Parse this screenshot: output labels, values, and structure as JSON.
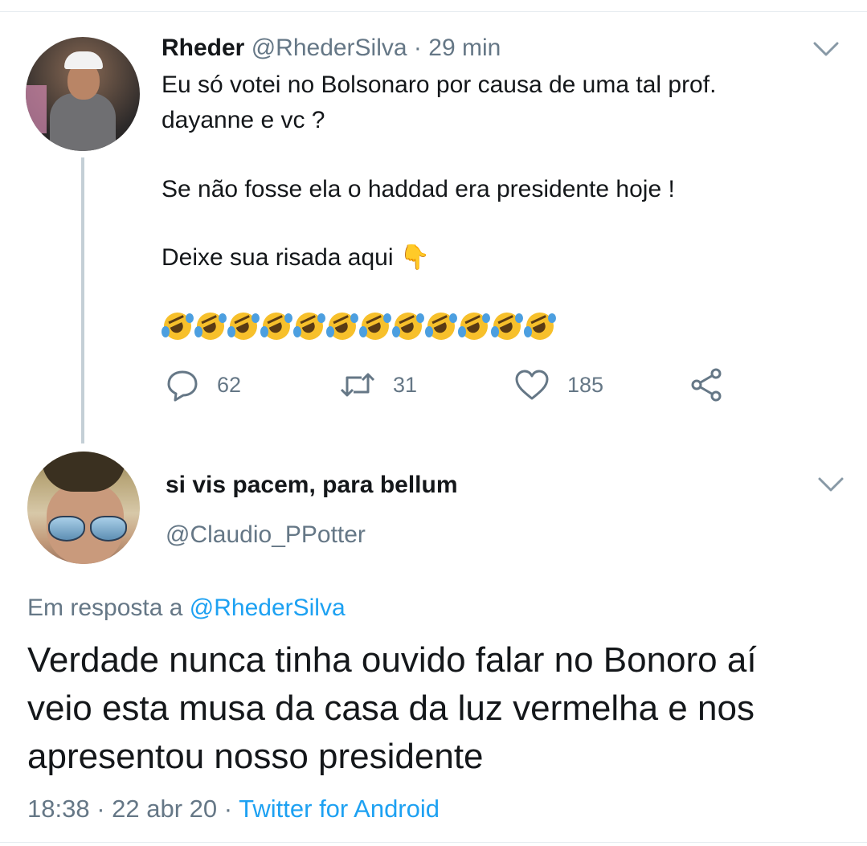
{
  "parent_tweet": {
    "display_name": "Rheder",
    "handle": "@RhederSilva",
    "separator": "·",
    "age": "29 min",
    "lines": [
      "Eu só votei no Bolsonaro por causa de uma tal prof.",
      "dayanne e vc ?",
      "Se não fosse ela o haddad era presidente hoje !",
      "Deixe sua risada aqui"
    ],
    "pointing_emoji": "👇",
    "laugh_emoji_count": 12,
    "actions": {
      "reply_count": "62",
      "retweet_count": "31",
      "like_count": "185"
    },
    "icons": [
      "chevron-down-icon",
      "reply-icon",
      "retweet-icon",
      "like-icon",
      "share-icon"
    ]
  },
  "reply_tweet": {
    "display_name": "si vis pacem, para bellum",
    "handle": "@Claudio_PPotter",
    "in_reply_to_label": "Em resposta a",
    "in_reply_to_handle": "@RhederSilva",
    "lines": [
      "Verdade nunca tinha ouvido falar no Bonoro aí",
      "veio esta musa da casa da luz vermelha e nos",
      "apresentou nosso presidente"
    ],
    "time": "18:38",
    "separator": "·",
    "date": "22 abr 20",
    "source": "Twitter for Android"
  },
  "colors": {
    "text": "#14171a",
    "secondary": "#657786",
    "link": "#1da1f2",
    "thread_line": "#c4cfd6",
    "divider": "#e6ecf0"
  }
}
